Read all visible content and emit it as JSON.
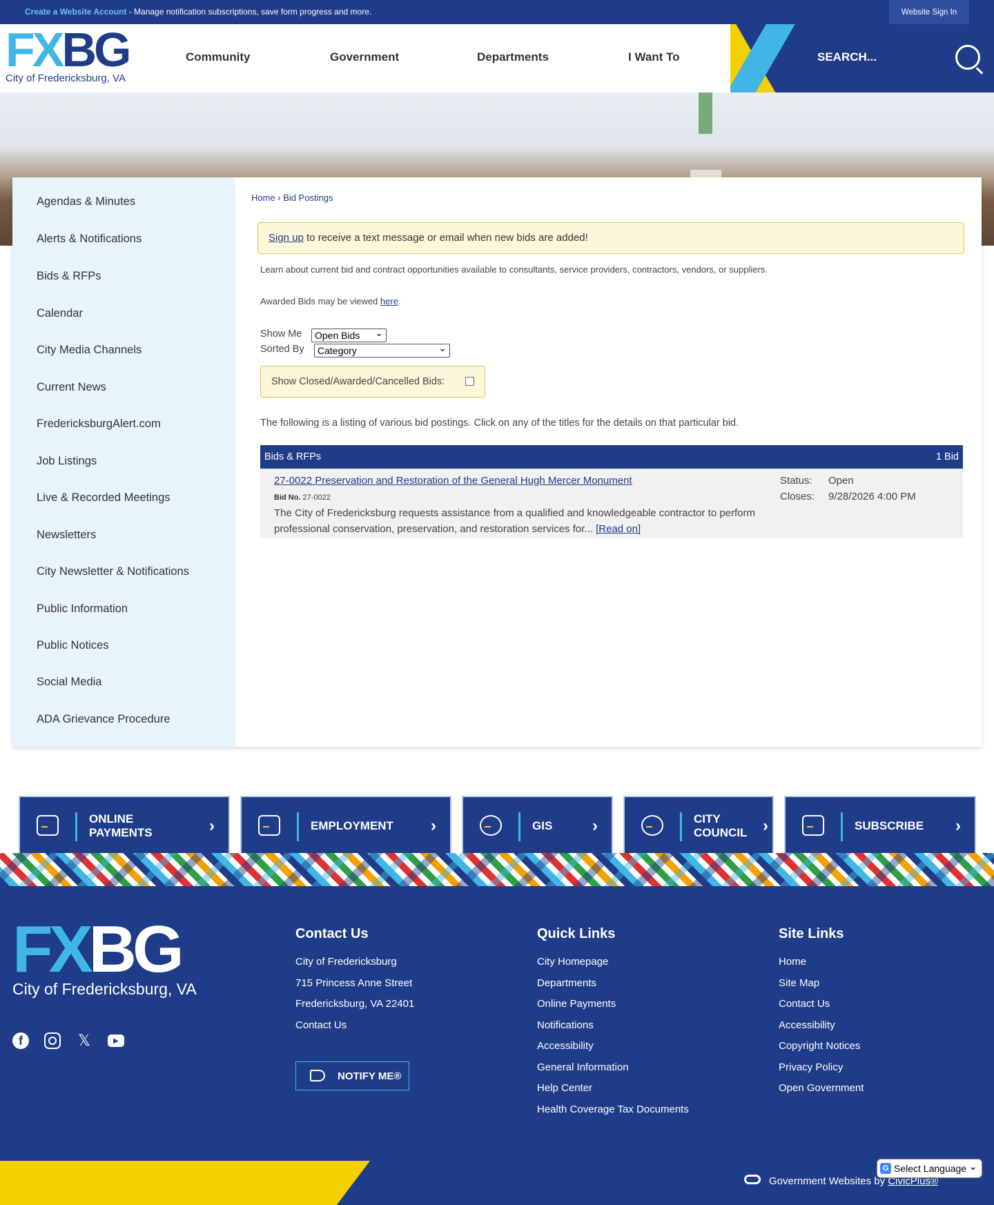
{
  "topbar": {
    "account_link": "Create a Website Account",
    "account_msg": " - Manage notification subscriptions, save form progress and more.",
    "signin": "Website Sign In"
  },
  "header": {
    "logo_fx": "FX",
    "logo_bg": "BG",
    "logo_city": "City of Fredericksburg, VA",
    "nav": [
      "Community",
      "Government",
      "Departments",
      "I Want To"
    ],
    "search_label": "SEARCH..."
  },
  "sidebar": {
    "items": [
      "Agendas & Minutes",
      "Alerts & Notifications",
      "Bids & RFPs",
      "Calendar",
      "City Media Channels",
      "Current News",
      "FredericksburgAlert.com",
      "Job Listings",
      "Live & Recorded Meetings",
      "Newsletters",
      "City Newsletter & Notifications",
      "Public Information",
      "Public Notices",
      "Social Media",
      "ADA Grievance Procedure"
    ]
  },
  "breadcrumb": {
    "home": "Home",
    "sep": " › ",
    "current": "Bid Postings"
  },
  "alert": {
    "link": "Sign up",
    "text": " to receive a text message or email when new bids are added!"
  },
  "intro": {
    "p1": "Learn about current bid and contract opportunities available to consultants, service providers, contractors, vendors, or suppliers.",
    "p2_before": "Awarded Bids may be viewed ",
    "p2_link": "here",
    "p2_after": "."
  },
  "filters": {
    "show_me_label": "Show Me",
    "show_me_value": "Open Bids",
    "sorted_by_label": "Sorted By",
    "sorted_by_value": "Category",
    "closed_label": "Show Closed/Awarded/Cancelled Bids:"
  },
  "listing_note": "The following is a listing of various bid postings. Click on any of the titles for the details on that particular bid.",
  "bid_list": {
    "category": "Bids & RFPs",
    "count": "1 Bid",
    "bids": [
      {
        "title": "27-0022 Preservation and Restoration of the General Hugh Mercer Monument",
        "bid_no_label": "Bid No.",
        "bid_no": " 27-0022",
        "description": "The City of Fredericksburg requests assistance from a qualified and knowledgeable contractor to perform professional conservation, preservation, and restoration services for... ",
        "read_on": "[Read on]",
        "status_label": "Status:",
        "status": "Open",
        "closes_label": "Closes:",
        "closes": "9/28/2026 4:00 PM"
      }
    ]
  },
  "tiles": [
    {
      "line1": "ONLINE",
      "line2": "PAYMENTS",
      "icon": "payments-icon"
    },
    {
      "line1": "EMPLOYMENT",
      "line2": "",
      "icon": "briefcase-icon"
    },
    {
      "line1": "GIS",
      "line2": "",
      "icon": "globe-search-icon"
    },
    {
      "line1": "CITY",
      "line2": "COUNCIL",
      "icon": "people-icon"
    },
    {
      "line1": "SUBSCRIBE",
      "line2": "",
      "icon": "envelope-icon"
    }
  ],
  "footer": {
    "logo_fx": "FX",
    "logo_bg": "BG",
    "logo_city": "City of Fredericksburg, VA",
    "contact": {
      "heading": "Contact Us",
      "lines": [
        "City of Fredericksburg",
        "715 Princess Anne Street",
        "Fredericksburg, VA 22401",
        "Contact Us"
      ]
    },
    "notify": "NOTIFY ME®",
    "quick_links": {
      "heading": "Quick Links",
      "links": [
        "City Homepage",
        "Departments",
        "Online Payments",
        "Notifications",
        "Accessibility",
        "General Information",
        "Help Center",
        "Health Coverage Tax Documents"
      ]
    },
    "site_links": {
      "heading": "Site Links",
      "links": [
        "Home",
        "Site Map",
        "Contact Us",
        "Accessibility",
        "Copyright Notices",
        "Privacy Policy",
        "Open Government"
      ]
    },
    "powered_by": "Government Websites by ",
    "powered_link": "CivicPlus®",
    "language": "Select Language"
  },
  "colors": {
    "brand_blue": "#1f3c88",
    "accent_cyan": "#41b6e6",
    "accent_yellow": "#f3d000"
  }
}
